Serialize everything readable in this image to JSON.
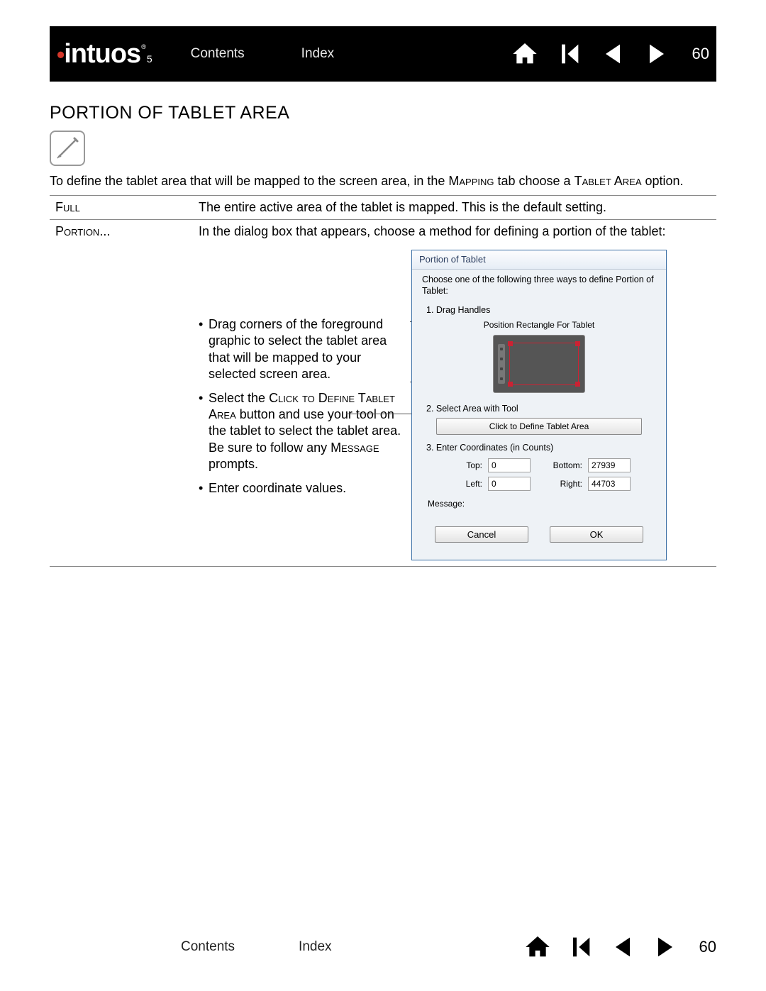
{
  "logo": {
    "brand": "intuos",
    "sub": "5"
  },
  "nav": {
    "contents": "Contents",
    "index": "Index"
  },
  "page_number": "60",
  "heading": "PORTION OF TABLET AREA",
  "intro_pre": "To define the tablet area that will be mapped to the screen area, in the ",
  "intro_sc1": "Mapping",
  "intro_mid": " tab choose a ",
  "intro_sc2": "Tablet Area",
  "intro_post": " option.",
  "rows": {
    "full": {
      "label": "Full",
      "desc": "The entire active area of the tablet is mapped.   This is the default setting."
    },
    "portion": {
      "label": "Portion...",
      "desc": "In the dialog box that appears, choose a method for defining a portion of the tablet:"
    }
  },
  "bullets": {
    "b1": "Drag corners of the foreground graphic to select the tablet area that will be mapped to your selected screen area.",
    "b2_pre": "Select the ",
    "b2_sc": "Click to Define Tablet Area",
    "b2_mid": " button and use your tool on the tablet to select the tablet area.  Be sure to follow any ",
    "b2_sc2": "Message",
    "b2_post": " prompts.",
    "b3": "Enter coordinate values."
  },
  "dialog": {
    "title": "Portion of Tablet",
    "instr": "Choose one of the following three ways to define Portion of Tablet:",
    "sec1": "1. Drag Handles",
    "sec1_sub": "Position Rectangle For Tablet",
    "sec2": "2. Select Area with Tool",
    "click_btn": "Click to Define Tablet Area",
    "sec3": "3. Enter Coordinates (in Counts)",
    "coords": {
      "top_label": "Top:",
      "top_val": "0",
      "bottom_label": "Bottom:",
      "bottom_val": "27939",
      "left_label": "Left:",
      "left_val": "0",
      "right_label": "Right:",
      "right_val": "44703"
    },
    "message_label": "Message:",
    "cancel": "Cancel",
    "ok": "OK"
  }
}
